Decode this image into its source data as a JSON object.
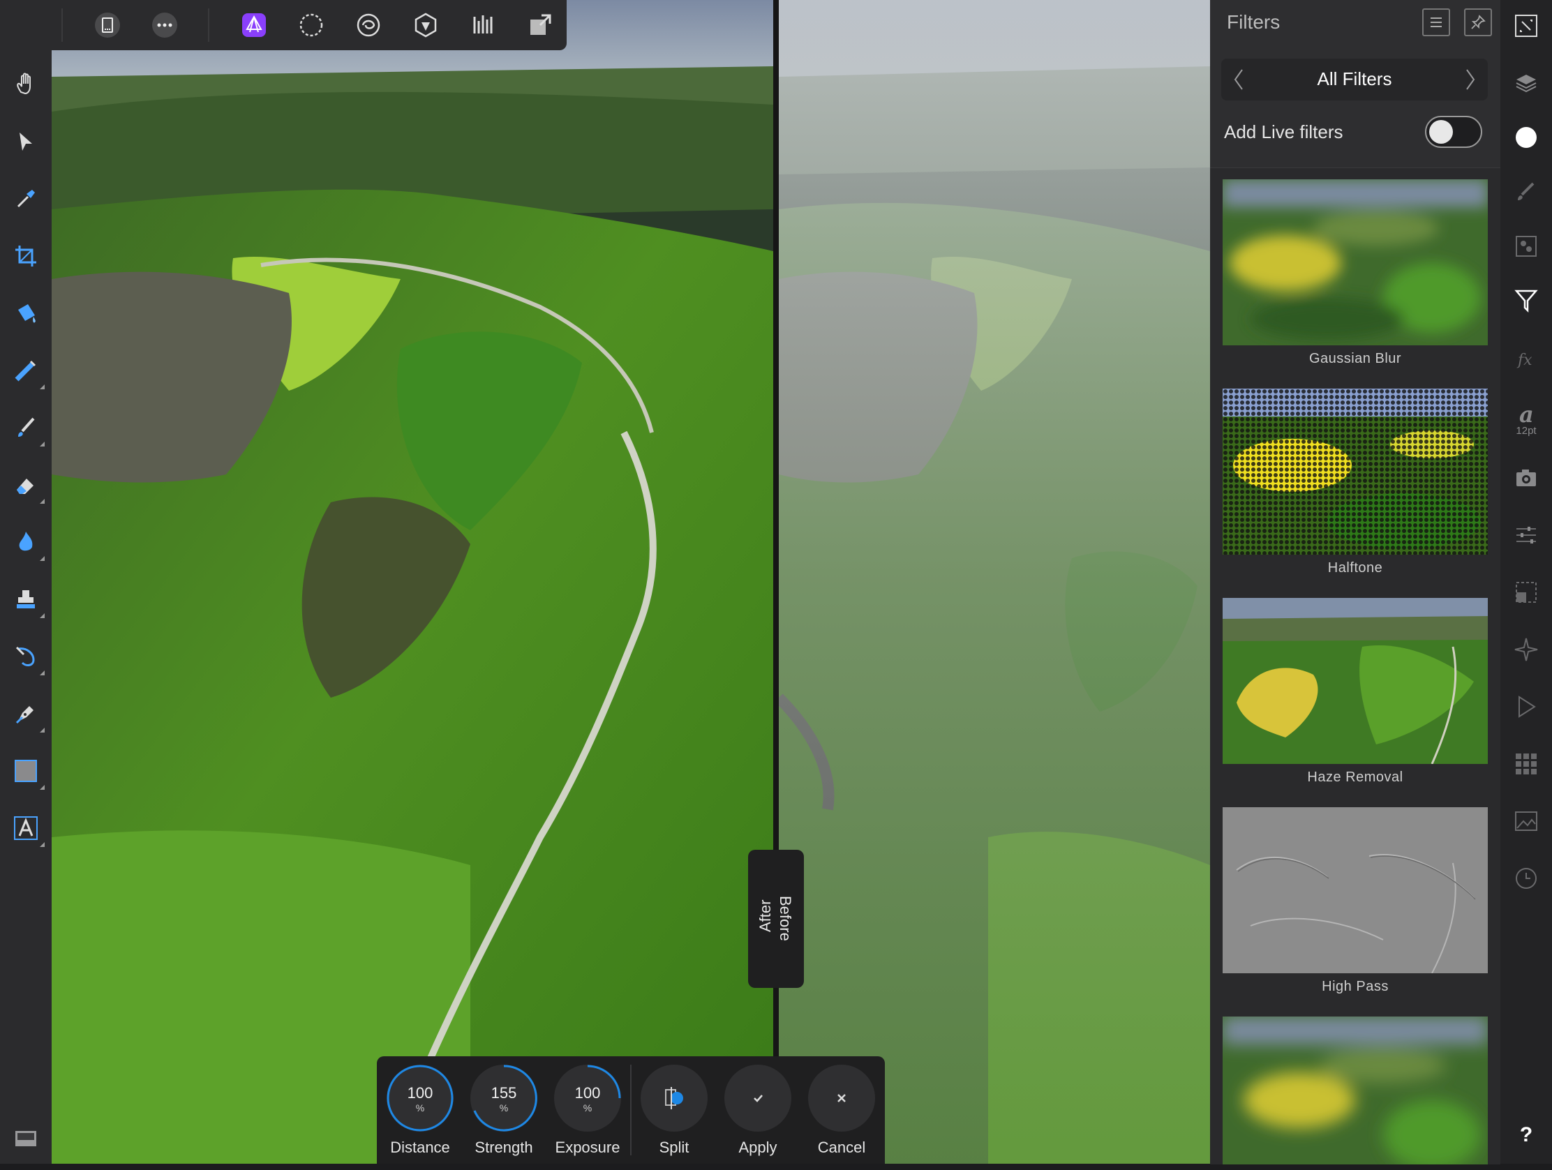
{
  "panel": {
    "title": "Filters",
    "category": "All Filters",
    "live_filters_label": "Add Live filters",
    "live_filters_enabled": false,
    "filters": [
      {
        "name": "Gaussian Blur"
      },
      {
        "name": "Halftone"
      },
      {
        "name": "Haze Removal"
      },
      {
        "name": "High Pass"
      },
      {
        "name": ""
      }
    ]
  },
  "compare": {
    "after_label": "After",
    "before_label": "Before"
  },
  "controls": {
    "distance": {
      "value": "100",
      "unit": "%",
      "label": "Distance"
    },
    "strength": {
      "value": "155",
      "unit": "%",
      "label": "Strength"
    },
    "exposure": {
      "value": "100",
      "unit": "%",
      "label": "Exposure"
    },
    "split_label": "Split",
    "apply_label": "Apply",
    "cancel_label": "Cancel"
  },
  "studio": {
    "font_size": "12pt",
    "help": "?"
  },
  "colors": {
    "accent": "#1e88e5",
    "persona_active": "#8a3ffc",
    "panel_bg": "#2e2e30"
  }
}
